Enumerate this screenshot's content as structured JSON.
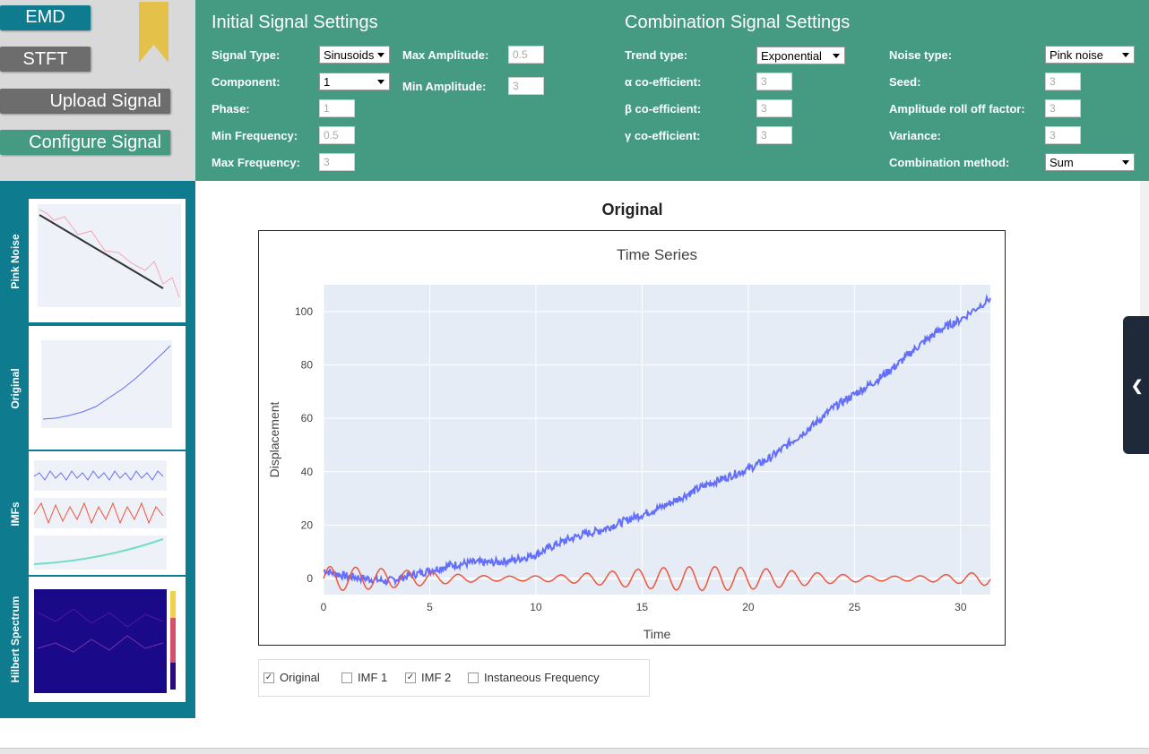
{
  "nav": {
    "emd": "EMD",
    "stft": "STFT",
    "upload": "Upload Signal",
    "configure": "Configure Signal"
  },
  "initial": {
    "title": "Initial Signal Settings",
    "signal_type_label": "Signal Type:",
    "signal_type_value": "Sinusoids",
    "component_label": "Component:",
    "component_value": "1",
    "phase_label": "Phase:",
    "phase_value": "1",
    "min_freq_label": "Min Frequency:",
    "min_freq_value": "0.5",
    "max_freq_label": "Max Frequency:",
    "max_freq_value": "3",
    "max_amp_label": "Max Amplitude:",
    "max_amp_value": "0.5",
    "min_amp_label": "Min Amplitude:",
    "min_amp_value": "3"
  },
  "combination": {
    "title": "Combination Signal Settings",
    "trend_type_label": "Trend type:",
    "trend_type_value": "Exponential",
    "alpha_label": "α co-efficient:",
    "alpha_value": "3",
    "beta_label": "β co-efficient:",
    "beta_value": "3",
    "gamma_label": "γ co-efficient:",
    "gamma_value": "3",
    "noise_type_label": "Noise type:",
    "noise_type_value": "Pink noise",
    "seed_label": "Seed:",
    "seed_value": "3",
    "rolloff_label": "Amplitude roll off factor:",
    "rolloff_value": "3",
    "variance_label": "Variance:",
    "variance_value": "3",
    "method_label": "Combination method:",
    "method_value": "Sum"
  },
  "thumbs": {
    "pink": "Pink Noise",
    "original": "Original",
    "imfs": "IMFs",
    "hilbert": "Hilbert Spectrum"
  },
  "main": {
    "heading": "Original"
  },
  "legend": {
    "original": "Original",
    "imf1": "IMF 1",
    "imf2": "IMF 2",
    "inst": "Instaneous Frequency",
    "original_checked": true,
    "imf1_checked": false,
    "imf2_checked": true,
    "inst_checked": false
  },
  "colors": {
    "settings_bg": "#459b82",
    "thumbs_bg": "#0e7b8f",
    "original_series": "#636efa",
    "imf2_series": "#ef553b",
    "plot_bg": "#e5ecf6"
  },
  "chart_data": {
    "type": "line",
    "title": "Time Series",
    "xlabel": "Time",
    "ylabel": "Displacement",
    "xlim": [
      0,
      31.4
    ],
    "ylim": [
      -6,
      110
    ],
    "xticks": [
      0,
      5,
      10,
      15,
      20,
      25,
      30
    ],
    "yticks": [
      0,
      20,
      40,
      60,
      80,
      100
    ],
    "grid": true,
    "series": [
      {
        "name": "Original",
        "color": "#636efa",
        "x": [
          0,
          1,
          2,
          3,
          4,
          5,
          6,
          7,
          8,
          9,
          10,
          11,
          12,
          13,
          14,
          15,
          16,
          17,
          18,
          19,
          20,
          21,
          22,
          23,
          24,
          25,
          26,
          27,
          28,
          29,
          30,
          31.4
        ],
        "y": [
          3,
          1,
          0,
          -1,
          1,
          3,
          5,
          6,
          6,
          7,
          9,
          13,
          16,
          18,
          21,
          24,
          27,
          31,
          35,
          38,
          41,
          45,
          51,
          57,
          64,
          69,
          74,
          80,
          87,
          93,
          97,
          105
        ]
      },
      {
        "name": "IMF 2",
        "color": "#ef553b",
        "x": [
          0,
          31.4
        ],
        "y": [
          0,
          0
        ]
      }
    ]
  }
}
